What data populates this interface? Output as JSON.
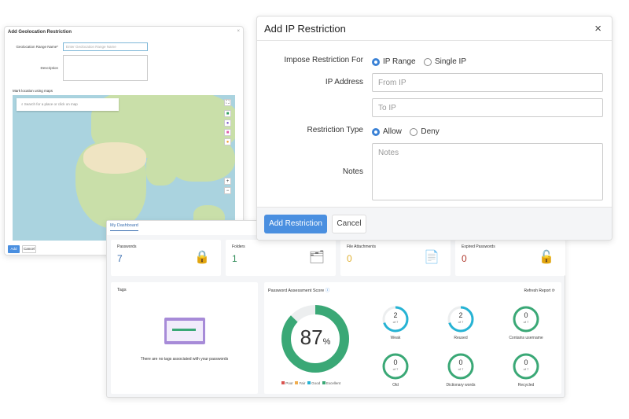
{
  "geo": {
    "title": "Add Geolocation Restriction",
    "name_label": "Geolocation Range Name*",
    "name_placeholder": "Enter Geolocation Range Name",
    "description_label": "Description",
    "map_label": "Mark location using maps",
    "search_placeholder": "Search for a place or click on map",
    "add": "Add",
    "cancel": "Cancel",
    "colors": {
      "green": "#2e9e5e",
      "purple": "#7a5cc9",
      "pink": "#e05aa8",
      "orange": "#f0a030"
    }
  },
  "ip": {
    "title": "Add IP Restriction",
    "impose_label": "Impose Restriction For",
    "impose_options": [
      "IP Range",
      "Single IP"
    ],
    "impose_selected": "IP Range",
    "ip_label": "IP Address",
    "from_placeholder": "From IP",
    "to_placeholder": "To IP",
    "type_label": "Restriction Type",
    "type_options": [
      "Allow",
      "Deny"
    ],
    "type_selected": "Allow",
    "notes_label": "Notes",
    "notes_placeholder": "Notes",
    "add_button": "Add Restriction",
    "cancel_button": "Cancel",
    "accent": "#4a8fe0"
  },
  "dash": {
    "tab": "My Dashboard",
    "cards": [
      {
        "label": "Passwords",
        "value": "7",
        "color": "#3b6fb0"
      },
      {
        "label": "Folders",
        "value": "1",
        "color": "#2e8b57"
      },
      {
        "label": "File Attachments",
        "value": "0",
        "color": "#e0b030"
      },
      {
        "label": "Expired Passwords",
        "value": "0",
        "color": "#b03a2e"
      }
    ],
    "tags_title": "Tags",
    "tags_empty": "There are no tags associated with your passwords",
    "pas_title": "Password Assessment Score",
    "refresh": "Refresh Report",
    "score": "87",
    "score_unit": "%",
    "score_percent": 87,
    "legend": [
      {
        "label": "Poor",
        "color": "#d9534f"
      },
      {
        "label": "Fair",
        "color": "#f0ad4e"
      },
      {
        "label": "Good",
        "color": "#26b3d4"
      },
      {
        "label": "Excellent",
        "color": "#3aa876"
      }
    ],
    "metrics": [
      {
        "label": "Weak",
        "value": "2",
        "of": "of 7",
        "count": 2
      },
      {
        "label": "Reused",
        "value": "2",
        "of": "of 7",
        "count": 2
      },
      {
        "label": "Contains username",
        "value": "0",
        "of": "of 7",
        "count": 0
      },
      {
        "label": "Old",
        "value": "0",
        "of": "of 7",
        "count": 0
      },
      {
        "label": "Dictionary words",
        "value": "0",
        "of": "of 7",
        "count": 0
      },
      {
        "label": "Recycled",
        "value": "0",
        "of": "of 7",
        "count": 0
      }
    ]
  }
}
